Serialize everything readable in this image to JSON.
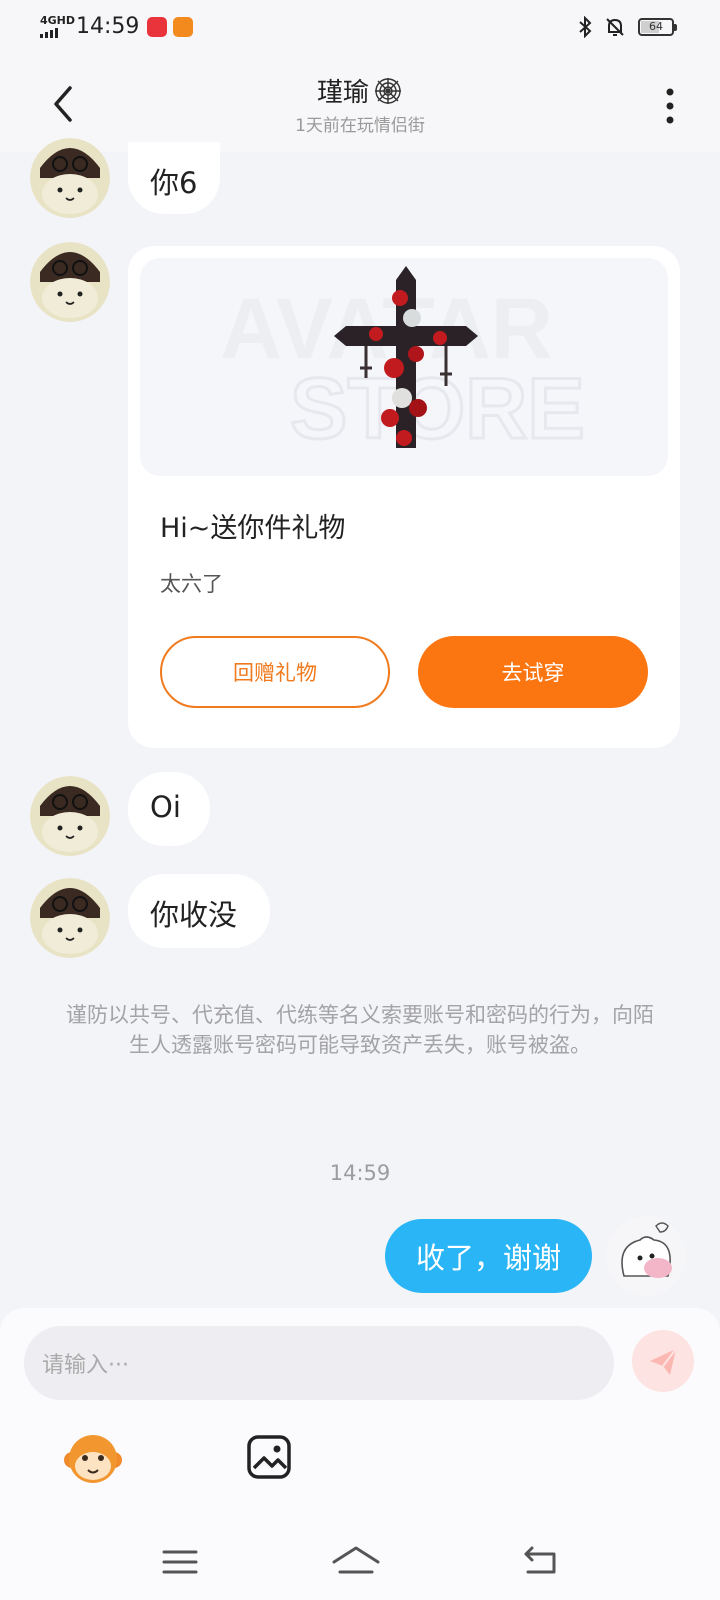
{
  "status_bar": {
    "network": "4GHD",
    "time": "14:59",
    "battery": "64",
    "battery_level_percent": 64,
    "icons": [
      "bluetooth-icon",
      "mute-bell-icon",
      "battery-icon"
    ]
  },
  "header": {
    "title": "瑾瑜",
    "title_icon": "spiderweb-icon",
    "subtitle": "1天前在玩情侣街",
    "back_icon": "chevron-left-icon",
    "more_icon": "more-vertical-icon"
  },
  "messages": [
    {
      "from": "other",
      "text": "你6"
    },
    {
      "from": "other",
      "type": "gift",
      "gift": {
        "title": "Hi~送你件礼物",
        "subtitle": "太六了",
        "return_label": "回赠礼物",
        "try_label": "去试穿"
      }
    },
    {
      "from": "other",
      "text": "Oi"
    },
    {
      "from": "other",
      "text": "你收没"
    }
  ],
  "notice": "谨防以共号、代充值、代练等名义索要账号和密码的行为，向陌生人透露账号密码可能导致资产丢失，账号被盗。",
  "timestamp": "14:59",
  "my_message": {
    "from": "me",
    "text": "收了，谢谢"
  },
  "composer": {
    "placeholder": "请输入···"
  },
  "colors": {
    "accent_orange": "#fb7511",
    "my_bubble_blue": "#2ab6f6",
    "background": "#f3f4f8"
  }
}
